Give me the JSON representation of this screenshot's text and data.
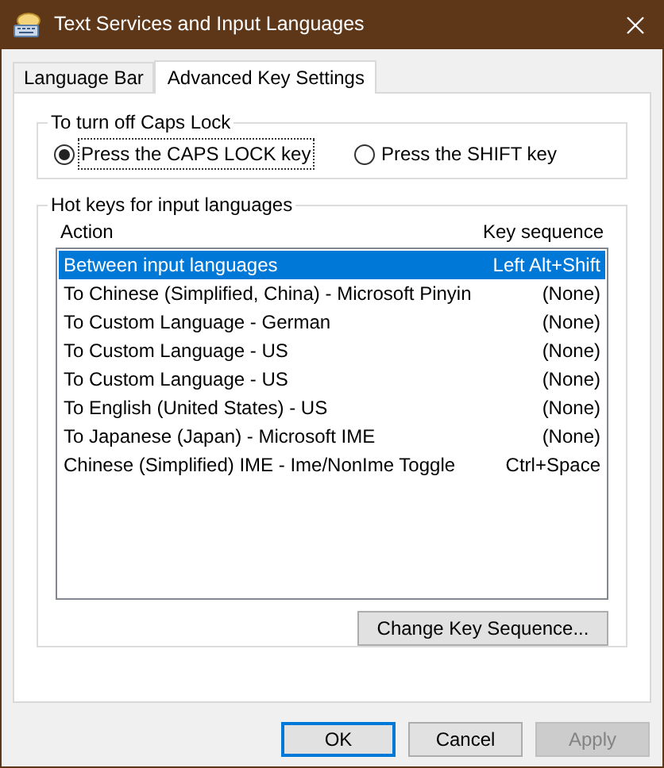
{
  "window": {
    "title": "Text Services and Input Languages"
  },
  "tabs": [
    {
      "label": "Language Bar",
      "selected": false
    },
    {
      "label": "Advanced Key Settings",
      "selected": true
    }
  ],
  "caps_lock": {
    "title": "To turn off Caps Lock",
    "options": [
      {
        "label": "Press the CAPS LOCK key",
        "selected": true
      },
      {
        "label": "Press the SHIFT key",
        "selected": false
      }
    ]
  },
  "hot_keys": {
    "title": "Hot keys for input languages",
    "columns": [
      "Action",
      "Key sequence"
    ],
    "rows": [
      {
        "action": "Between input languages",
        "keys": "Left Alt+Shift",
        "selected": true
      },
      {
        "action": "To Chinese (Simplified, China) - Microsoft Pinyin",
        "keys": "(None)",
        "selected": false
      },
      {
        "action": "To Custom Language - German",
        "keys": "(None)",
        "selected": false
      },
      {
        "action": "To Custom Language - US",
        "keys": "(None)",
        "selected": false
      },
      {
        "action": "To Custom Language - US",
        "keys": "(None)",
        "selected": false
      },
      {
        "action": "To English (United States) - US",
        "keys": "(None)",
        "selected": false
      },
      {
        "action": "To Japanese (Japan) - Microsoft IME",
        "keys": "(None)",
        "selected": false
      },
      {
        "action": "Chinese (Simplified) IME - Ime/NonIme Toggle",
        "keys": "Ctrl+Space",
        "selected": false
      }
    ],
    "change_button": "Change Key Sequence..."
  },
  "buttons": [
    {
      "label": "OK",
      "kind": "default",
      "disabled": false
    },
    {
      "label": "Cancel",
      "kind": "normal",
      "disabled": false
    },
    {
      "label": "Apply",
      "kind": "normal",
      "disabled": true
    }
  ]
}
